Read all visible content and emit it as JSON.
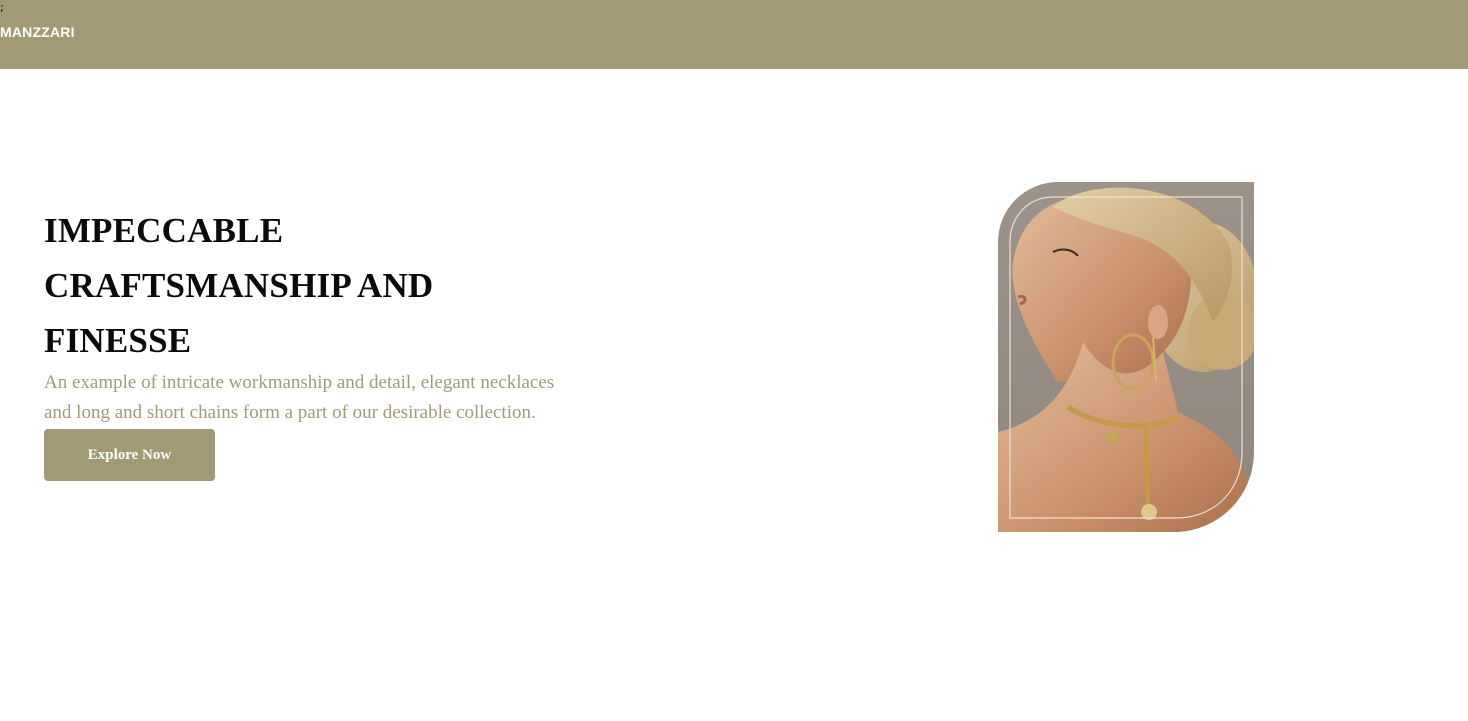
{
  "header": {
    "stray_text": ";",
    "brand": "MANZZARI"
  },
  "hero": {
    "headline": "IMPECCABLE CRAFTSMANSHIP AND FINESSE",
    "description": "An example of intricate workmanship and detail, elegant necklaces and long and short chains form a part of our desirable collection.",
    "cta_label": "Explore Now",
    "image_alt": "Model wearing gold hoop earrings and a gold chain necklace"
  },
  "colors": {
    "accent": "#a29a77",
    "text_dark": "#0b0b0b",
    "background": "#ffffff"
  }
}
